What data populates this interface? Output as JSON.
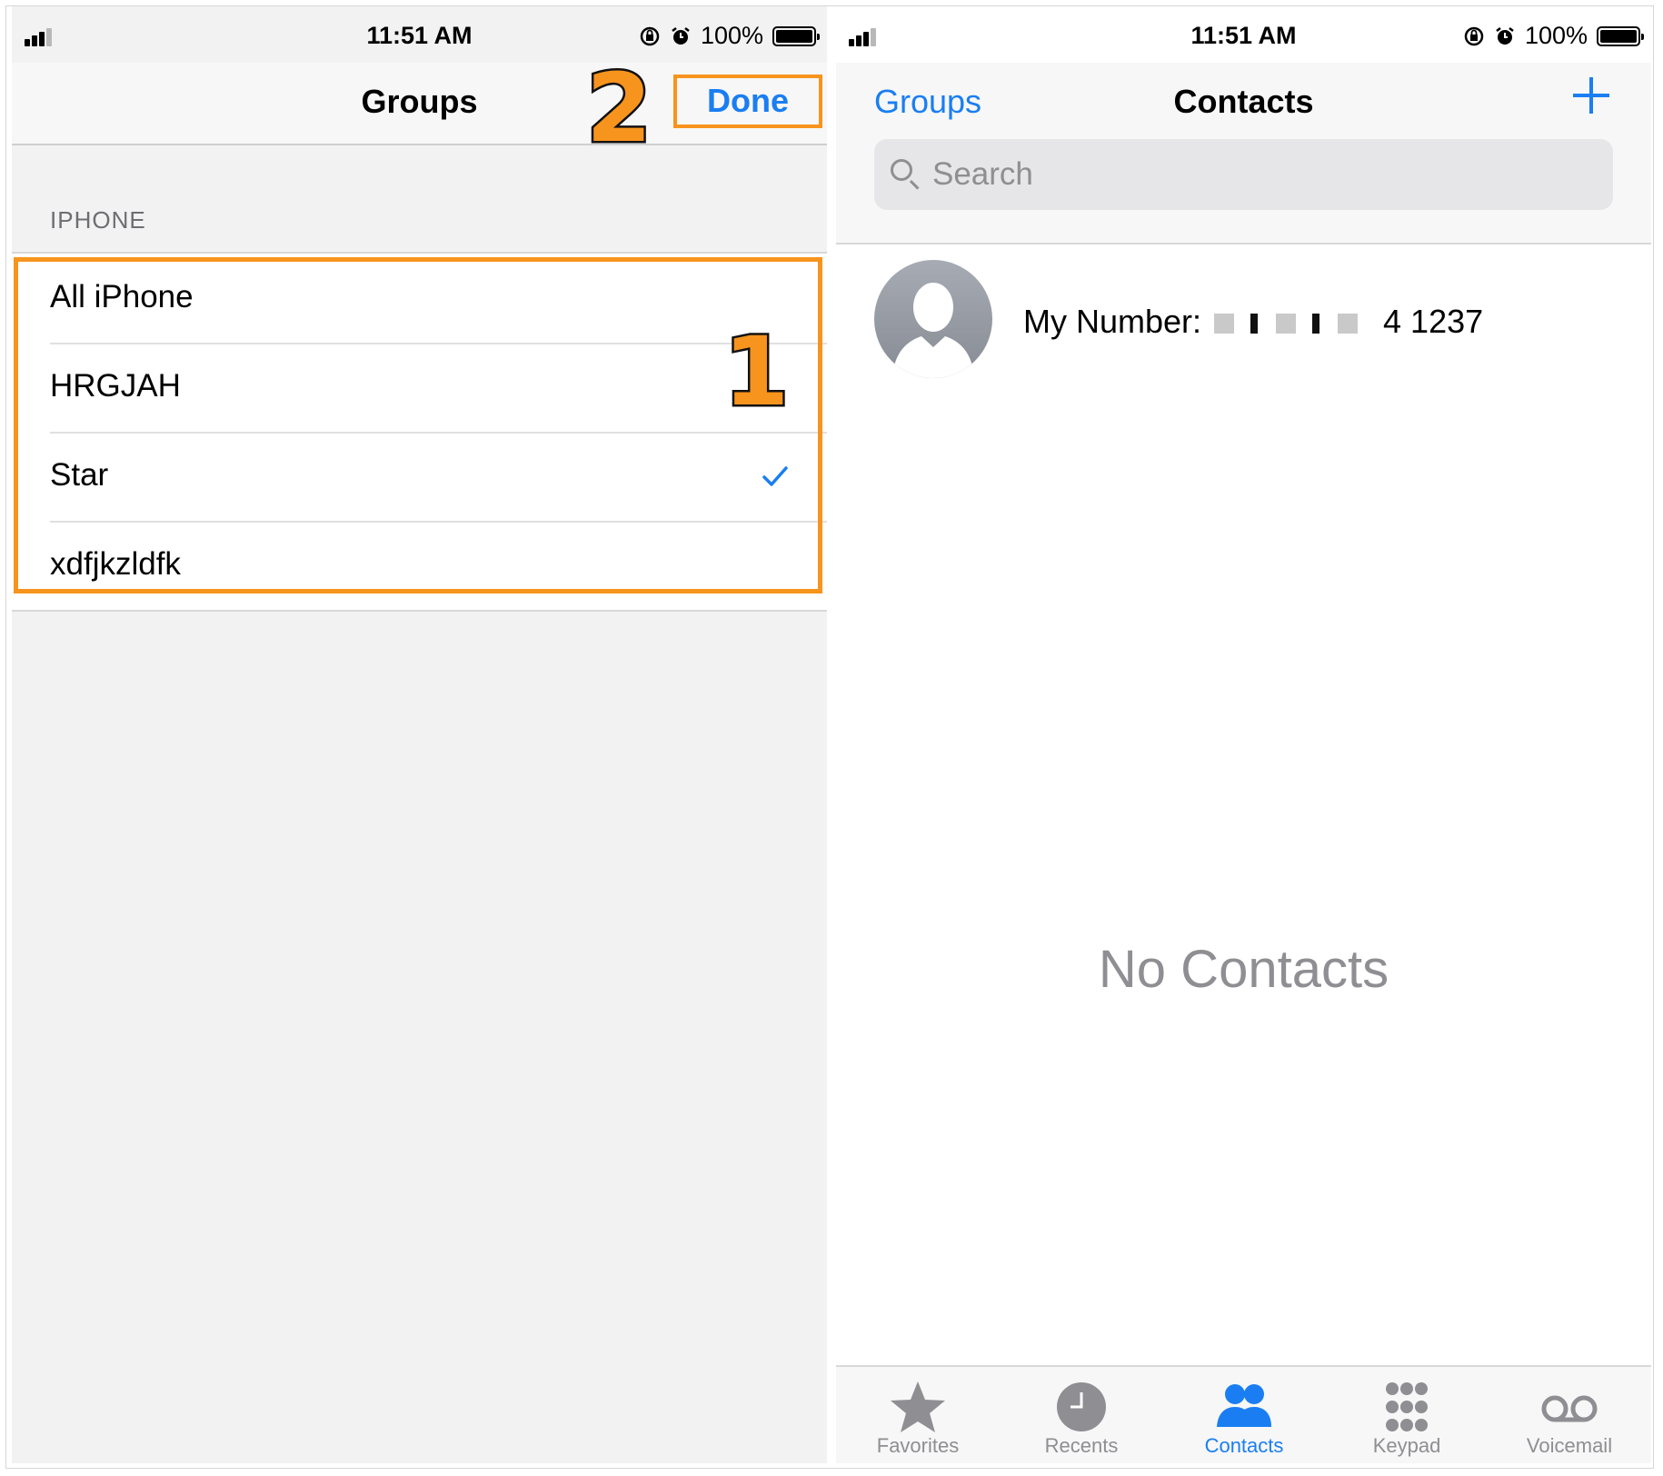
{
  "status_bar": {
    "time": "11:51 AM",
    "battery": "100%"
  },
  "groups_screen": {
    "title": "Groups",
    "done_label": "Done",
    "section_header": "IPHONE",
    "groups": [
      {
        "label": "All iPhone",
        "checked": false
      },
      {
        "label": "HRGJAH",
        "checked": false
      },
      {
        "label": "Star",
        "checked": true
      },
      {
        "label": "xdfjkzldfk",
        "checked": false
      }
    ],
    "annotations": {
      "step_1": "1",
      "step_2": "2"
    }
  },
  "contacts_screen": {
    "back_label": "Groups",
    "title": "Contacts",
    "search_placeholder": "Search",
    "my_number_label": "My Number:",
    "my_number_visible_suffix": "4 1237",
    "empty_state": "No Contacts",
    "tabs": [
      {
        "label": "Favorites",
        "icon": "star-icon",
        "active": false
      },
      {
        "label": "Recents",
        "icon": "clock-icon",
        "active": false
      },
      {
        "label": "Contacts",
        "icon": "contacts-icon",
        "active": true
      },
      {
        "label": "Keypad",
        "icon": "keypad-icon",
        "active": false
      },
      {
        "label": "Voicemail",
        "icon": "voicemail-icon",
        "active": false
      }
    ]
  },
  "colors": {
    "accent": "#1a7ef2",
    "highlight": "#f7941d",
    "secondary_text": "#8e8e93"
  }
}
